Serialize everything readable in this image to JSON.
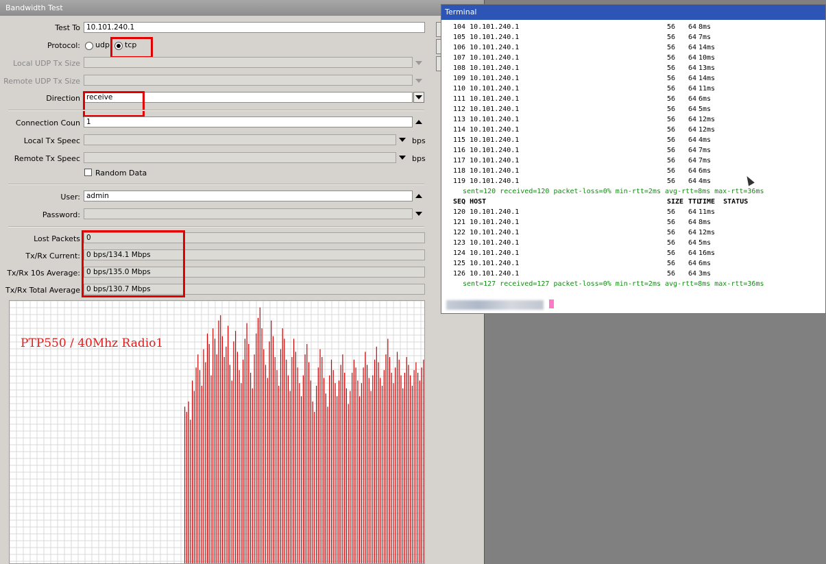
{
  "bandwidth_test": {
    "title": "Bandwidth Test",
    "test_to": {
      "label": "Test To",
      "value": "10.101.240.1"
    },
    "protocol": {
      "label": "Protocol:",
      "options": [
        "udp",
        "tcp"
      ],
      "selected": "tcp"
    },
    "local_udp_tx_size": {
      "label": "Local UDP Tx Size"
    },
    "remote_udp_tx_size": {
      "label": "Remote UDP Tx Size"
    },
    "direction": {
      "label": "Direction",
      "value": "receive"
    },
    "connection_count": {
      "label": "Connection Coun",
      "value": "1"
    },
    "local_tx_speed": {
      "label": "Local Tx Speec",
      "unit": "bps"
    },
    "remote_tx_speed": {
      "label": "Remote Tx Speec",
      "unit": "bps"
    },
    "random_data": {
      "label": "Random Data",
      "checked": false
    },
    "user": {
      "label": "User:",
      "value": "admin"
    },
    "password": {
      "label": "Password:",
      "value": ""
    },
    "lost_packets": {
      "label": "Lost Packets",
      "value": "0"
    },
    "txrx_current": {
      "label": "Tx/Rx Current:",
      "value": "0 bps/134.1 Mbps"
    },
    "txrx_10s_avg": {
      "label": "Tx/Rx 10s Average:",
      "value": "0 bps/135.0 Mbps"
    },
    "txrx_total_avg": {
      "label": "Tx/Rx Total Average",
      "value": "0 bps/130.7 Mbps"
    }
  },
  "graph": {
    "caption": "PTP550 / 40Mhz Radio1",
    "bar_color": "#cc0000",
    "grid_color": "#d9d9d9"
  },
  "chart_data": {
    "type": "bar",
    "title": "",
    "series": [
      {
        "values": [
          0.6,
          0.58,
          0.62,
          0.55,
          0.7,
          0.66,
          0.75,
          0.8,
          0.74,
          0.68,
          0.82,
          0.77,
          0.88,
          0.84,
          0.72,
          0.9,
          0.86,
          0.8,
          0.93,
          0.95,
          0.87,
          0.79,
          0.83,
          0.91,
          0.76,
          0.7,
          0.85,
          0.89,
          0.81,
          0.74,
          0.69,
          0.78,
          0.86,
          0.92,
          0.84,
          0.73,
          0.67,
          0.8,
          0.88,
          0.94,
          0.98,
          0.9,
          0.82,
          0.76,
          0.71,
          0.85,
          0.93,
          0.87,
          0.79,
          0.74,
          0.68,
          0.82,
          0.9,
          0.86,
          0.78,
          0.72,
          0.66,
          0.79,
          0.86,
          0.81,
          0.75,
          0.69,
          0.64,
          0.72,
          0.8,
          0.84,
          0.77,
          0.7,
          0.62,
          0.58,
          0.68,
          0.75,
          0.82,
          0.79,
          0.71,
          0.65,
          0.6,
          0.72,
          0.78,
          0.74,
          0.69,
          0.64,
          0.7,
          0.76,
          0.8,
          0.73,
          0.67,
          0.61,
          0.66,
          0.73,
          0.78,
          0.75,
          0.7,
          0.64,
          0.69,
          0.75,
          0.81,
          0.76,
          0.71,
          0.66,
          0.72,
          0.78,
          0.83,
          0.77,
          0.71,
          0.68,
          0.74,
          0.8,
          0.86,
          0.79,
          0.73,
          0.69,
          0.75,
          0.81,
          0.78,
          0.72,
          0.67,
          0.73,
          0.79,
          0.76,
          0.72,
          0.68,
          0.74,
          0.77,
          0.73,
          0.7,
          0.75,
          0.78
        ]
      }
    ],
    "ylim": [
      0,
      1
    ]
  },
  "terminal": {
    "title": "Terminal",
    "rows_top": [
      {
        "seq": "104",
        "host": "10.101.240.1",
        "size": "56",
        "ttl": "64",
        "time": "8ms"
      },
      {
        "seq": "105",
        "host": "10.101.240.1",
        "size": "56",
        "ttl": "64",
        "time": "7ms"
      },
      {
        "seq": "106",
        "host": "10.101.240.1",
        "size": "56",
        "ttl": "64",
        "time": "14ms"
      },
      {
        "seq": "107",
        "host": "10.101.240.1",
        "size": "56",
        "ttl": "64",
        "time": "10ms"
      },
      {
        "seq": "108",
        "host": "10.101.240.1",
        "size": "56",
        "ttl": "64",
        "time": "13ms"
      },
      {
        "seq": "109",
        "host": "10.101.240.1",
        "size": "56",
        "ttl": "64",
        "time": "14ms"
      },
      {
        "seq": "110",
        "host": "10.101.240.1",
        "size": "56",
        "ttl": "64",
        "time": "11ms"
      },
      {
        "seq": "111",
        "host": "10.101.240.1",
        "size": "56",
        "ttl": "64",
        "time": "6ms"
      },
      {
        "seq": "112",
        "host": "10.101.240.1",
        "size": "56",
        "ttl": "64",
        "time": "5ms"
      },
      {
        "seq": "113",
        "host": "10.101.240.1",
        "size": "56",
        "ttl": "64",
        "time": "12ms"
      },
      {
        "seq": "114",
        "host": "10.101.240.1",
        "size": "56",
        "ttl": "64",
        "time": "12ms"
      },
      {
        "seq": "115",
        "host": "10.101.240.1",
        "size": "56",
        "ttl": "64",
        "time": "4ms"
      },
      {
        "seq": "116",
        "host": "10.101.240.1",
        "size": "56",
        "ttl": "64",
        "time": "7ms"
      },
      {
        "seq": "117",
        "host": "10.101.240.1",
        "size": "56",
        "ttl": "64",
        "time": "7ms"
      },
      {
        "seq": "118",
        "host": "10.101.240.1",
        "size": "56",
        "ttl": "64",
        "time": "6ms"
      },
      {
        "seq": "119",
        "host": "10.101.240.1",
        "size": "56",
        "ttl": "64",
        "time": "4ms"
      }
    ],
    "summary1": "sent=120 received=120 packet-loss=0% min-rtt=2ms avg-rtt=8ms max-rtt=36ms",
    "header": {
      "seq": "SEQ",
      "host": "HOST",
      "size": "SIZE",
      "ttl": "TTL",
      "time": "TIME",
      "status": "STATUS"
    },
    "rows_bottom": [
      {
        "seq": "120",
        "host": "10.101.240.1",
        "size": "56",
        "ttl": "64",
        "time": "11ms"
      },
      {
        "seq": "121",
        "host": "10.101.240.1",
        "size": "56",
        "ttl": "64",
        "time": "8ms"
      },
      {
        "seq": "122",
        "host": "10.101.240.1",
        "size": "56",
        "ttl": "64",
        "time": "12ms"
      },
      {
        "seq": "123",
        "host": "10.101.240.1",
        "size": "56",
        "ttl": "64",
        "time": "5ms"
      },
      {
        "seq": "124",
        "host": "10.101.240.1",
        "size": "56",
        "ttl": "64",
        "time": "16ms"
      },
      {
        "seq": "125",
        "host": "10.101.240.1",
        "size": "56",
        "ttl": "64",
        "time": "6ms"
      },
      {
        "seq": "126",
        "host": "10.101.240.1",
        "size": "56",
        "ttl": "64",
        "time": "3ms"
      }
    ],
    "summary2": "sent=127 received=127 packet-loss=0% min-rtt=2ms avg-rtt=8ms max-rtt=36ms"
  }
}
